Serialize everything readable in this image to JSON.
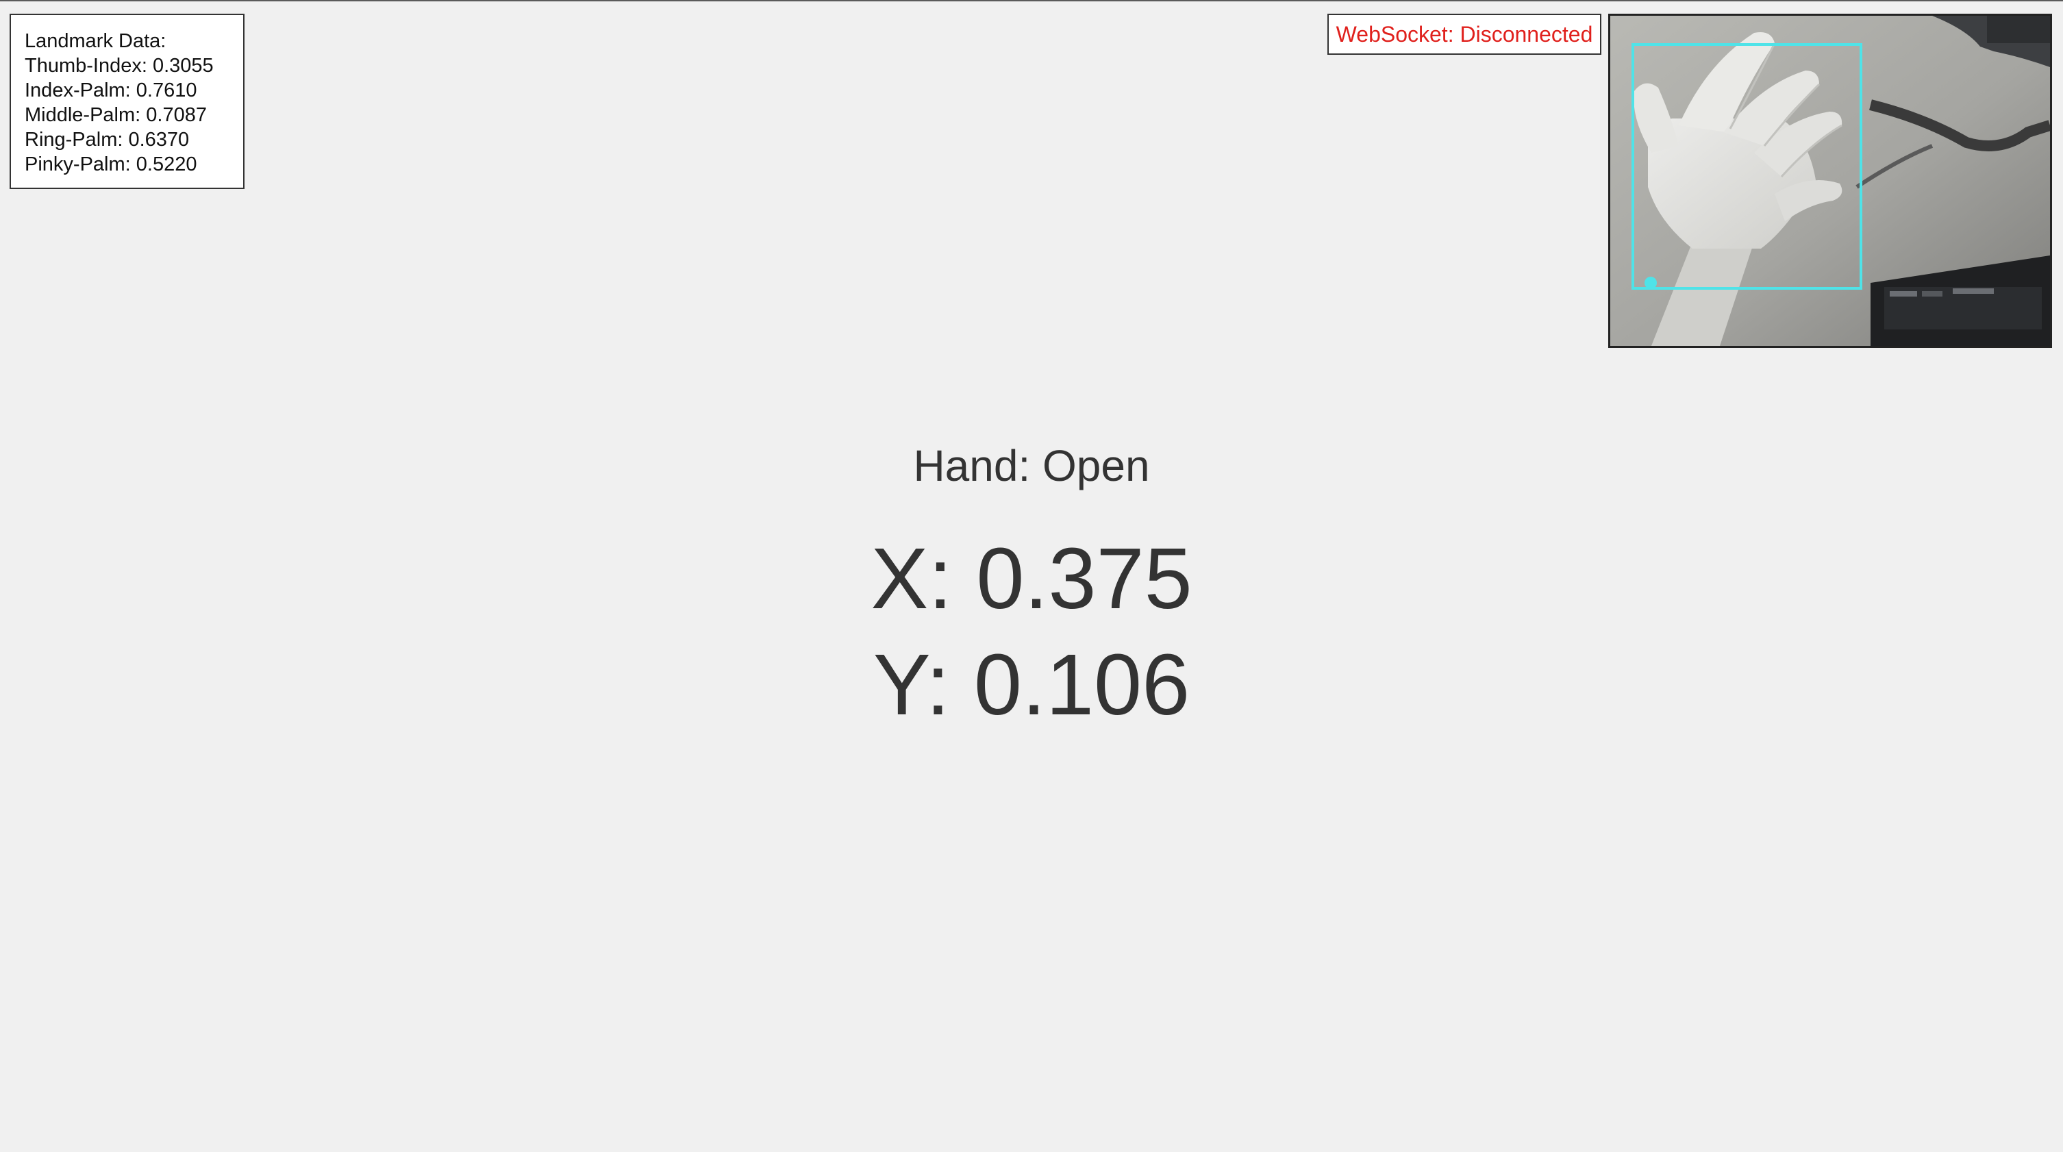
{
  "landmark_panel": {
    "title": "Landmark Data:",
    "rows": [
      "Thumb-Index: 0.3055",
      "Index-Palm: 0.7610",
      "Middle-Palm: 0.7087",
      "Ring-Palm: 0.6370",
      "Pinky-Palm: 0.5220"
    ]
  },
  "websocket": {
    "status": "WebSocket: Disconnected",
    "status_color": "#e0201c"
  },
  "camera": {
    "bbox_color": "#4fe3e8"
  },
  "hand": {
    "state": "Hand: Open"
  },
  "coords": {
    "x_label": "X: 0.375",
    "y_label": "Y: 0.106"
  }
}
